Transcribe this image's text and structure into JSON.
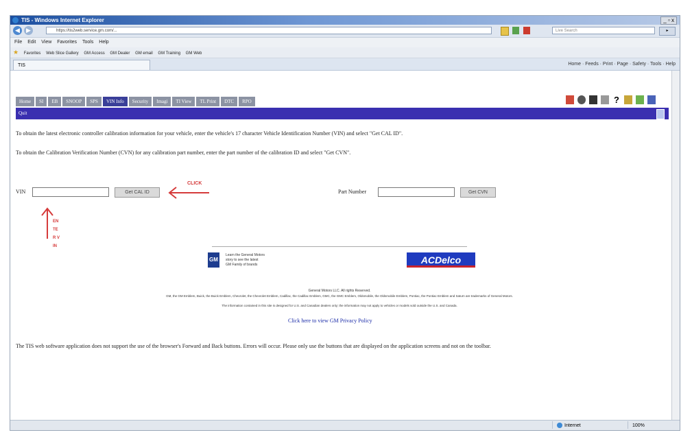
{
  "window": {
    "title": "TIS - Windows Internet Explorer",
    "controls": "_ ▫ x"
  },
  "browser": {
    "address": "https://tis2web.service.gm.com/...",
    "search_placeholder": "Live Search",
    "search_button": "▸",
    "menu": [
      "File",
      "Edit",
      "View",
      "Favorites",
      "Tools",
      "Help"
    ],
    "favorites_label": "Favorites",
    "favorites_links": [
      "Web Slice Gallery",
      "GM Access",
      "GM Dealer",
      "GM email",
      "GM Training",
      "GM Web"
    ],
    "tab_title": "TIS",
    "command_bar": "Home · Feeds · Print · Page · Safety · Tools · Help",
    "status_zone": "Internet",
    "status_zoom": "100%"
  },
  "app": {
    "nav_tabs": [
      "Home",
      "SI",
      "EB",
      "SNOOP",
      "SPS",
      "VIN Info",
      "Security",
      "Imagi",
      "TI View",
      "TL Print",
      "DTC",
      "RPO"
    ],
    "active_tab_index": 5,
    "banner": "Quit",
    "instruction1": "To obtain the latest electronic controller calibration information for your vehicle, enter the vehicle's 17 character Vehicle Identification Number (VIN) and select \"Get CAL ID\".",
    "instruction2": "To obtain the Calibration Verification Number (CVN) for any calibration part number, enter the part number of the calibration ID and select \"Get CVN\".",
    "vin_label": "VIN",
    "vin_value": "",
    "get_cal_button": "Get CAL ID",
    "part_label": "Part Number",
    "part_value": "",
    "get_cvn_button": "Get CVN",
    "annotation_click": "CLICK",
    "annotation_enter": "ENTER VIN",
    "gm_text": [
      "Learn the General Motors",
      "story to see the latest",
      "GM Family of brands"
    ],
    "gm_logo": "GM",
    "acdelco_logo": "ACDelco",
    "copyright_line": "General Motors LLC. All rights Reserved.",
    "legal_line1": "GM, the GM Emblem, Buick, the Buick Emblem, Chevrolet, the Chevrolet Emblem, Cadillac, the Cadillac Emblem, GMC, the GMC Emblem, Oldsmobile, the Oldsmobile Emblem, Pontiac, the Pontiac Emblem and Saturn are trademarks of General Motors.",
    "legal_line2": "The information contained in this site is designed for U.S. and Canadian dealers only; the information may not apply to vehicles or models sold outside the U.S. and Canada.",
    "privacy_link": "Click here to view GM Privacy Policy",
    "bottom_note": "The TIS web software application does not support the use of the browser's Forward and Back buttons. Errors will occur. Please only use the buttons that are displayed on the application screens and not on the toolbar."
  }
}
